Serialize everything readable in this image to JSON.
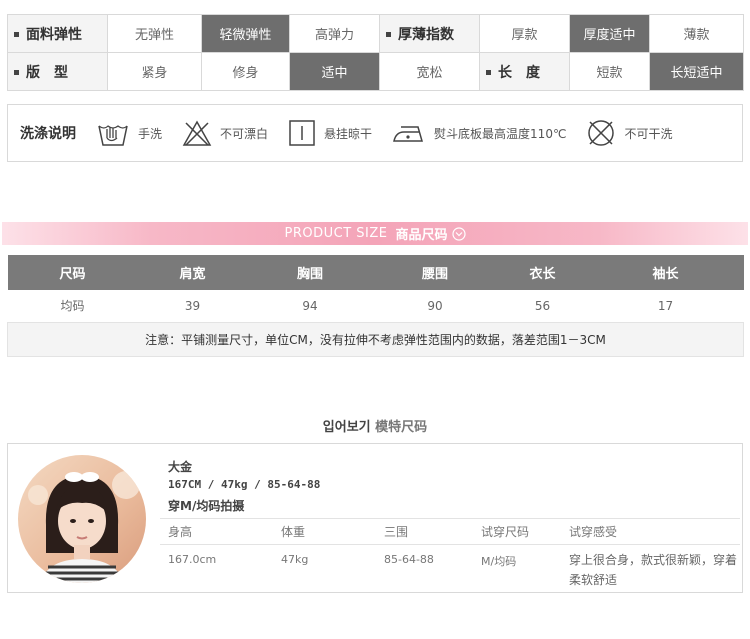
{
  "attributes": {
    "rows": [
      {
        "groups": [
          {
            "label": "面料弹性",
            "options": [
              {
                "text": "无弹性",
                "selected": false
              },
              {
                "text": "轻微弹性",
                "selected": true
              },
              {
                "text": "高弹力",
                "selected": false
              }
            ]
          },
          {
            "label": "厚薄指数",
            "options": [
              {
                "text": "厚款",
                "selected": false
              },
              {
                "text": "厚度适中",
                "selected": true
              },
              {
                "text": "薄款",
                "selected": false
              }
            ]
          }
        ]
      },
      {
        "groups": [
          {
            "label": "版　型",
            "options": [
              {
                "text": "紧身",
                "selected": false
              },
              {
                "text": "修身",
                "selected": false
              },
              {
                "text": "适中",
                "selected": true
              },
              {
                "text": "宽松",
                "selected": false
              }
            ]
          },
          {
            "label": "长　度",
            "options": [
              {
                "text": "短款",
                "selected": false
              },
              {
                "text": "长短适中",
                "selected": true
              },
              {
                "text": "长款",
                "selected": false
              }
            ]
          }
        ]
      }
    ]
  },
  "washing": {
    "title": "洗涤说明",
    "items": [
      {
        "icon": "hand-wash-icon",
        "label": "手洗"
      },
      {
        "icon": "no-bleach-icon",
        "label": "不可漂白"
      },
      {
        "icon": "hang-dry-icon",
        "label": "悬挂晾干"
      },
      {
        "icon": "iron-icon",
        "label": "熨斗底板最高温度110℃"
      },
      {
        "icon": "no-dry-clean-icon",
        "label": "不可干洗"
      }
    ]
  },
  "size_banner": {
    "en": "PRODUCT SIZE",
    "zh": "商品尺码",
    "icon": "chevron-down-circle-icon"
  },
  "size_table": {
    "headers": [
      "尺码",
      "肩宽",
      "胸围",
      "腰围",
      "衣长",
      "袖长"
    ],
    "rows": [
      [
        "均码",
        "39",
        "94",
        "90",
        "56",
        "17"
      ]
    ],
    "note": "注意：平铺测量尺寸，单位CM，没有拉伸不考虑弹性范围内的数据，落差范围1－3CM"
  },
  "model": {
    "heading_ko": "입어보기",
    "heading_zh": "模特尺码",
    "name": "大金",
    "stats": "167CM / 47kg / 85-64-88",
    "wearing": "穿M/均码拍摄",
    "table_headers": [
      "身高",
      "体重",
      "三围",
      "试穿尺码",
      "试穿感受"
    ],
    "table_values": [
      "167.0cm",
      "47kg",
      "85-64-88",
      "M/均码",
      "穿上很合身，款式很新颖，穿着柔软舒适"
    ]
  },
  "colors": {
    "selected_bg": "#6e6e6e",
    "banner_pink": "#f4a4b8",
    "header_gray": "#7a7a7a"
  }
}
